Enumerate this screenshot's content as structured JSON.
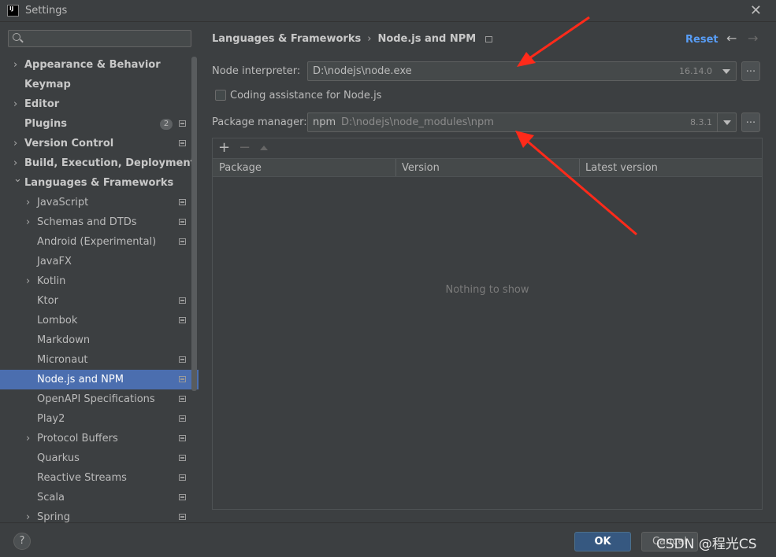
{
  "window": {
    "title": "Settings",
    "logo_text": "IJ"
  },
  "sidebar": {
    "search_placeholder": "",
    "items": [
      {
        "label": "Appearance & Behavior",
        "bold": true,
        "chevron": "right",
        "indent": 0
      },
      {
        "label": "Keymap",
        "bold": true,
        "chevron": "",
        "indent": 0
      },
      {
        "label": "Editor",
        "bold": true,
        "chevron": "right",
        "indent": 0
      },
      {
        "label": "Plugins",
        "bold": true,
        "chevron": "",
        "indent": 0,
        "badge": "2",
        "proj": true
      },
      {
        "label": "Version Control",
        "bold": true,
        "chevron": "right",
        "indent": 0,
        "proj": true
      },
      {
        "label": "Build, Execution, Deployment",
        "bold": true,
        "chevron": "right",
        "indent": 0
      },
      {
        "label": "Languages & Frameworks",
        "bold": true,
        "chevron": "down",
        "indent": 0
      },
      {
        "label": "JavaScript",
        "chevron": "right",
        "indent": 1,
        "proj": true
      },
      {
        "label": "Schemas and DTDs",
        "chevron": "right",
        "indent": 1,
        "proj": true
      },
      {
        "label": "Android (Experimental)",
        "chevron": "",
        "indent": 1,
        "proj": true
      },
      {
        "label": "JavaFX",
        "chevron": "",
        "indent": 1
      },
      {
        "label": "Kotlin",
        "chevron": "right",
        "indent": 1
      },
      {
        "label": "Ktor",
        "chevron": "",
        "indent": 1,
        "proj": true
      },
      {
        "label": "Lombok",
        "chevron": "",
        "indent": 1,
        "proj": true
      },
      {
        "label": "Markdown",
        "chevron": "",
        "indent": 1
      },
      {
        "label": "Micronaut",
        "chevron": "",
        "indent": 1,
        "proj": true
      },
      {
        "label": "Node.js and NPM",
        "chevron": "",
        "indent": 1,
        "proj": true,
        "selected": true
      },
      {
        "label": "OpenAPI Specifications",
        "chevron": "",
        "indent": 1,
        "proj": true
      },
      {
        "label": "Play2",
        "chevron": "",
        "indent": 1,
        "proj": true
      },
      {
        "label": "Protocol Buffers",
        "chevron": "right",
        "indent": 1,
        "proj": true
      },
      {
        "label": "Quarkus",
        "chevron": "",
        "indent": 1,
        "proj": true
      },
      {
        "label": "Reactive Streams",
        "chevron": "",
        "indent": 1,
        "proj": true
      },
      {
        "label": "Scala",
        "chevron": "",
        "indent": 1,
        "proj": true
      },
      {
        "label": "Spring",
        "chevron": "right",
        "indent": 1,
        "proj": true
      }
    ]
  },
  "header": {
    "breadcrumb_parent": "Languages & Frameworks",
    "breadcrumb_sep": "›",
    "breadcrumb_current": "Node.js and NPM",
    "reset_label": "Reset",
    "back_icon": "←",
    "forward_icon": "→"
  },
  "node_interpreter": {
    "label": "Node interpreter:",
    "value": "D:\\nodejs\\node.exe",
    "version": "16.14.0",
    "more_label": "..."
  },
  "coding_assistance": {
    "label": "Coding assistance for Node.js",
    "checked": false
  },
  "package_manager": {
    "label": "Package manager:",
    "value": "npm",
    "path": "D:\\nodejs\\node_modules\\npm",
    "version": "8.3.1",
    "more_label": "..."
  },
  "packages_table": {
    "add_icon": "+",
    "remove_icon": "−",
    "columns": [
      "Package",
      "Version",
      "Latest version"
    ],
    "rows": [],
    "empty_text": "Nothing to show"
  },
  "footer": {
    "help_label": "?",
    "ok_label": "OK",
    "cancel_label": "Cancel",
    "watermark": "CSDN @程光CS"
  },
  "colors": {
    "background": "#3c3f41",
    "selection": "#4b6eaf",
    "accent_link": "#589df6",
    "primary_button": "#365880",
    "annotation_arrow": "#ff2a1a"
  }
}
